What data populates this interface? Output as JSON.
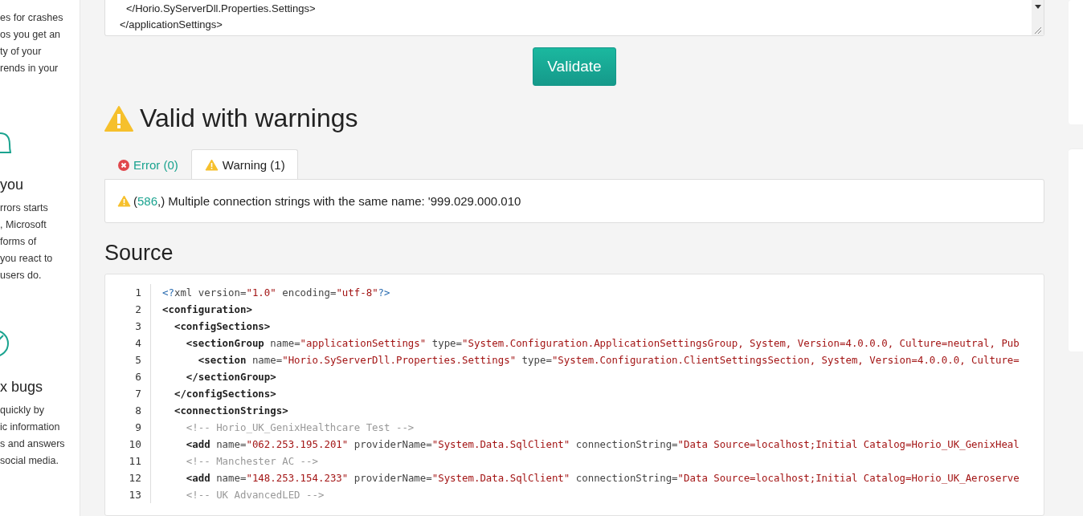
{
  "sidebar": {
    "sections": [
      {
        "lines": [
          "es for crashes",
          "os you get an",
          "ty of your",
          "rends in your"
        ]
      },
      {
        "heading": "you",
        "lines": [
          "rrors starts",
          ", Microsoft",
          "forms of",
          "you react to",
          "users do."
        ]
      },
      {
        "heading": "x bugs",
        "lines": [
          "quickly by",
          "ic information",
          "s and answers",
          "social media."
        ]
      }
    ]
  },
  "config_input": {
    "lines": [
      "</Horio.SyServerDll.Properties.Settings>",
      "</applicationSettings>"
    ]
  },
  "validate_button": "Validate",
  "result": {
    "kind": "warning",
    "title": "Valid with warnings"
  },
  "tabs": [
    {
      "kind": "error",
      "label": "Error (0)",
      "selected": false
    },
    {
      "kind": "warning",
      "label": "Warning (1)",
      "selected": true
    }
  ],
  "messages": [
    {
      "kind": "warning",
      "open": "(",
      "line_link": "586",
      "text": ",) Multiple connection strings with the same name: '999.029.000.010"
    }
  ],
  "source": {
    "title": "Source",
    "lines": [
      {
        "number": "1",
        "tokens": [
          {
            "kind": "meta",
            "text": "<?"
          },
          {
            "kind": "attr",
            "text": "xml version="
          },
          {
            "kind": "value",
            "text": "\"1.0\""
          },
          {
            "kind": "attr",
            "text": " encoding="
          },
          {
            "kind": "value",
            "text": "\"utf-8\""
          },
          {
            "kind": "meta",
            "text": "?>"
          }
        ]
      },
      {
        "number": "2",
        "tokens": [
          {
            "kind": "tag",
            "text": "<configuration>"
          }
        ]
      },
      {
        "number": "3",
        "tokens": [
          {
            "kind": "tag",
            "text": "  <configSections>"
          }
        ]
      },
      {
        "number": "4",
        "tokens": [
          {
            "kind": "tag",
            "text": "    <sectionGroup"
          },
          {
            "kind": "attr",
            "text": " name="
          },
          {
            "kind": "value",
            "text": "\"applicationSettings\""
          },
          {
            "kind": "attr",
            "text": " type="
          },
          {
            "kind": "value",
            "text": "\"System.Configuration.ApplicationSettingsGroup, System, Version=4.0.0.0, Culture=neutral, Pub"
          }
        ]
      },
      {
        "number": "5",
        "tokens": [
          {
            "kind": "tag",
            "text": "      <section"
          },
          {
            "kind": "attr",
            "text": " name="
          },
          {
            "kind": "value",
            "text": "\"Horio.SyServerDll.Properties.Settings\""
          },
          {
            "kind": "attr",
            "text": " type="
          },
          {
            "kind": "value",
            "text": "\"System.Configuration.ClientSettingsSection, System, Version=4.0.0.0, Culture="
          }
        ]
      },
      {
        "number": "6",
        "tokens": [
          {
            "kind": "tag",
            "text": "    </sectionGroup>"
          }
        ]
      },
      {
        "number": "7",
        "tokens": [
          {
            "kind": "tag",
            "text": "  </configSections>"
          }
        ]
      },
      {
        "number": "8",
        "tokens": [
          {
            "kind": "tag",
            "text": "  <connectionStrings>"
          }
        ]
      },
      {
        "number": "9",
        "tokens": [
          {
            "kind": "comment",
            "text": "    <!-- Horio_UK_GenixHealthcare Test -->"
          }
        ]
      },
      {
        "number": "10",
        "tokens": [
          {
            "kind": "tag",
            "text": "    <add"
          },
          {
            "kind": "attr",
            "text": " name="
          },
          {
            "kind": "value",
            "text": "\"062.253.195.201\""
          },
          {
            "kind": "attr",
            "text": " providerName="
          },
          {
            "kind": "value",
            "text": "\"System.Data.SqlClient\""
          },
          {
            "kind": "attr",
            "text": " connectionString="
          },
          {
            "kind": "value",
            "text": "\"Data Source=localhost;Initial Catalog=Horio_UK_GenixHeal"
          }
        ]
      },
      {
        "number": "11",
        "tokens": [
          {
            "kind": "comment",
            "text": "    <!-- Manchester AC -->"
          }
        ]
      },
      {
        "number": "12",
        "tokens": [
          {
            "kind": "tag",
            "text": "    <add"
          },
          {
            "kind": "attr",
            "text": " name="
          },
          {
            "kind": "value",
            "text": "\"148.253.154.233\""
          },
          {
            "kind": "attr",
            "text": " providerName="
          },
          {
            "kind": "value",
            "text": "\"System.Data.SqlClient\""
          },
          {
            "kind": "attr",
            "text": " connectionString="
          },
          {
            "kind": "value",
            "text": "\"Data Source=localhost;Initial Catalog=Horio_UK_Aeroserve"
          }
        ]
      },
      {
        "number": "13",
        "tokens": [
          {
            "kind": "comment",
            "text": "    <!-- UK AdvancedLED -->"
          }
        ]
      }
    ]
  }
}
